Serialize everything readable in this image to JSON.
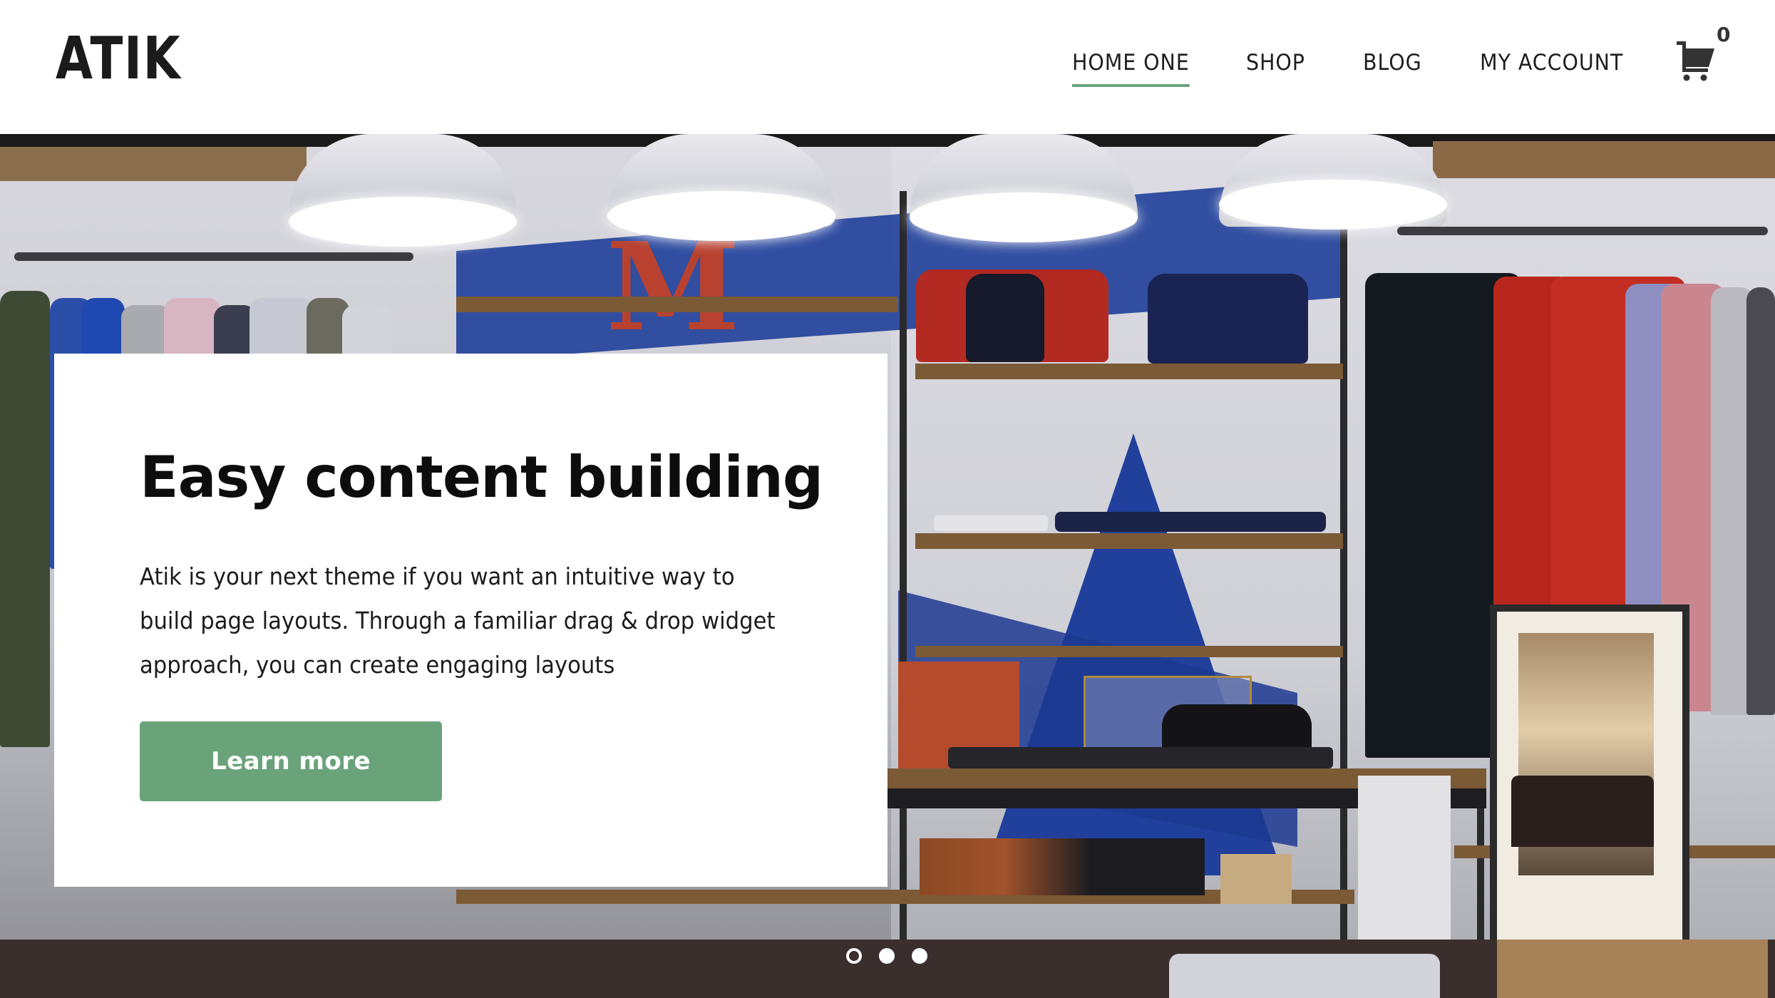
{
  "brand": {
    "logo_text": "ATIK",
    "accent_color": "#6aa37a"
  },
  "nav": {
    "items": [
      {
        "label": "HOME ONE",
        "active": true
      },
      {
        "label": "SHOP",
        "active": false
      },
      {
        "label": "BLOG",
        "active": false
      },
      {
        "label": "MY ACCOUNT",
        "active": false
      }
    ],
    "cart": {
      "icon": "shopping-cart-icon",
      "count": "0"
    }
  },
  "hero": {
    "background": "store interior photo",
    "card": {
      "title": "Easy content building",
      "text": "Atik is your next theme if you want an intuitive way to build page layouts. Through a familiar drag & drop widget approach, you can create engaging layouts",
      "button_label": "Learn more"
    },
    "slider": {
      "total_slides": 3,
      "active_index": 0
    }
  }
}
